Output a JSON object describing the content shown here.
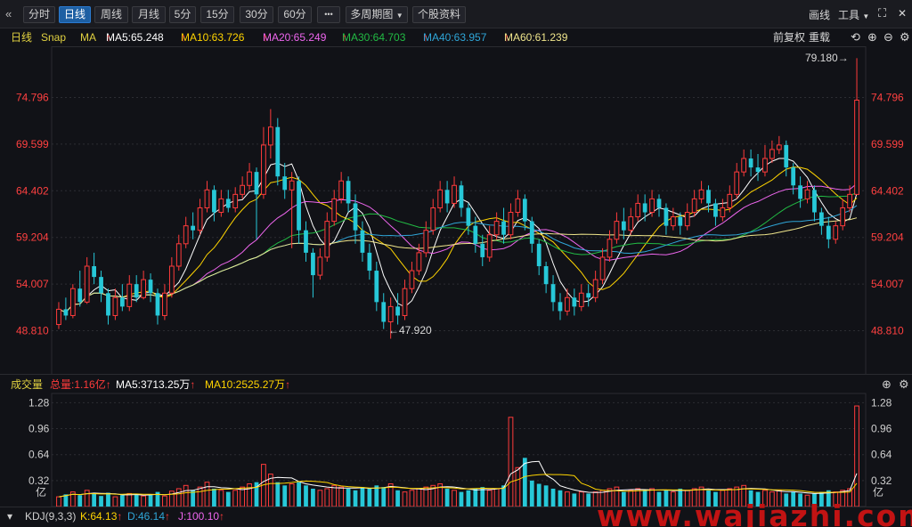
{
  "toolbar": {
    "back_glyph": "«",
    "periods": [
      "分时",
      "日线",
      "周线",
      "月线",
      "5分",
      "15分",
      "30分",
      "60分"
    ],
    "active_period": "日线",
    "more_glyph": "•••",
    "multi_period": "多周期图",
    "multi_period_arrow": "▼",
    "stock_info": "个股资料",
    "draw": "画线",
    "tools": "工具",
    "tools_arrow": "▼",
    "fullscreen_glyph": "⛶",
    "close_glyph": "✕"
  },
  "info": {
    "period_label": "日线",
    "snap": "Snap",
    "ma_label": "MA",
    "ma5": "MA5:65.248",
    "ma10": "MA10:63.726",
    "ma20": "MA20:65.249",
    "ma30": "MA30:64.703",
    "ma40": "MA40:63.957",
    "ma60": "MA60:61.239",
    "up_arrow": "↑",
    "adjust": "前复权",
    "overlay": "重载",
    "undo_glyph": "⟲",
    "zoom_in": "⊕",
    "zoom_out": "⊖",
    "settings_glyph": "⚙"
  },
  "price_axis": [
    "74.796",
    "69.599",
    "64.402",
    "59.204",
    "54.007",
    "48.810"
  ],
  "annotations": {
    "high": "79.180",
    "low": "47.920",
    "right_arrow": "→",
    "left_arrow": "←"
  },
  "volume": {
    "label": "成交量",
    "total": "总量:1.16亿",
    "ma5": "MA5:3713.25万",
    "ma10": "MA10:2525.27万",
    "up_arrow": "↑",
    "axis": [
      "1.28",
      "0.96",
      "0.64",
      "0.32"
    ],
    "unit": "亿",
    "settings_glyph": "⚙",
    "zoom_in": "⊕"
  },
  "kdj": {
    "collapse_glyph": "▾",
    "label": "KDJ(9,3,3)",
    "k": "K:64.13",
    "d": "D:46.14",
    "j": "J:100.10",
    "up_arrow": "↑",
    "settings_glyph": "⚙",
    "zoom_in": "⊕"
  },
  "watermark": "www.wajiazhi.com",
  "colors": {
    "up": "#ff3b3b",
    "down": "#27c8d8",
    "ma5": "#ffffff",
    "ma10": "#ffd400",
    "ma20": "#ee66ee",
    "ma30": "#22bb44",
    "ma40": "#2fa6d8",
    "ma60": "#f0e68c"
  },
  "chart_data": {
    "type": "candlestick",
    "price_range": [
      44.0,
      80.5
    ],
    "price_ticks": [
      74.796,
      69.599,
      64.402,
      59.204,
      54.007,
      48.81
    ],
    "volume_range_yi": [
      0,
      1.35
    ],
    "volume_ticks_yi": [
      1.28,
      0.96,
      0.64,
      0.32
    ],
    "candles": [
      [
        49.5,
        51.2,
        52.0,
        49.0
      ],
      [
        51.2,
        50.5,
        52.5,
        50.0
      ],
      [
        50.5,
        53.5,
        54.0,
        50.2
      ],
      [
        53.5,
        52.0,
        55.5,
        51.5
      ],
      [
        52.0,
        56.0,
        57.0,
        51.8
      ],
      [
        56.0,
        54.8,
        57.5,
        54.0
      ],
      [
        54.8,
        53.0,
        55.5,
        52.0
      ],
      [
        53.0,
        50.5,
        53.5,
        49.5
      ],
      [
        50.5,
        52.5,
        53.5,
        50.0
      ],
      [
        52.5,
        51.5,
        54.0,
        51.0
      ],
      [
        51.5,
        54.0,
        55.0,
        51.0
      ],
      [
        54.0,
        52.5,
        55.0,
        52.0
      ],
      [
        52.5,
        54.5,
        55.5,
        52.3
      ],
      [
        54.5,
        53.0,
        55.2,
        52.0
      ],
      [
        53.0,
        50.5,
        53.5,
        49.5
      ],
      [
        50.5,
        53.0,
        54.0,
        50.0
      ],
      [
        53.0,
        56.0,
        57.0,
        52.5
      ],
      [
        56.0,
        58.5,
        59.5,
        55.5
      ],
      [
        58.5,
        60.5,
        61.5,
        58.0
      ],
      [
        60.5,
        60.0,
        62.0,
        59.0
      ],
      [
        60.0,
        62.5,
        63.5,
        59.5
      ],
      [
        62.5,
        64.5,
        65.5,
        62.0
      ],
      [
        64.5,
        62.0,
        65.0,
        61.0
      ],
      [
        62.0,
        63.5,
        64.5,
        61.5
      ],
      [
        63.5,
        62.5,
        64.5,
        62.0
      ],
      [
        62.5,
        64.0,
        64.8,
        62.0
      ],
      [
        64.0,
        65.0,
        66.0,
        63.5
      ],
      [
        65.0,
        66.5,
        67.5,
        64.5
      ],
      [
        66.5,
        64.0,
        67.0,
        59.0
      ],
      [
        64.0,
        69.5,
        71.5,
        63.5
      ],
      [
        69.5,
        71.5,
        73.5,
        68.0
      ],
      [
        71.5,
        66.0,
        72.5,
        65.0
      ],
      [
        66.0,
        64.5,
        67.5,
        63.5
      ],
      [
        64.5,
        65.5,
        66.5,
        58.0
      ],
      [
        65.5,
        60.0,
        66.0,
        58.5
      ],
      [
        60.0,
        57.5,
        61.0,
        56.5
      ],
      [
        57.5,
        55.0,
        58.0,
        52.5
      ],
      [
        55.0,
        57.0,
        58.0,
        54.5
      ],
      [
        57.0,
        61.0,
        62.0,
        56.5
      ],
      [
        61.0,
        63.5,
        64.5,
        60.5
      ],
      [
        63.5,
        65.5,
        66.5,
        63.0
      ],
      [
        65.5,
        63.0,
        66.0,
        62.0
      ],
      [
        63.0,
        60.0,
        64.0,
        58.5
      ],
      [
        60.0,
        57.5,
        61.0,
        56.5
      ],
      [
        57.5,
        55.5,
        58.5,
        54.5
      ],
      [
        55.5,
        52.0,
        56.5,
        51.0
      ],
      [
        52.0,
        49.8,
        53.0,
        49.0
      ],
      [
        49.8,
        51.5,
        52.5,
        47.92
      ],
      [
        51.5,
        50.5,
        53.0,
        49.5
      ],
      [
        50.5,
        53.5,
        54.5,
        50.0
      ],
      [
        53.5,
        55.5,
        56.5,
        53.0
      ],
      [
        55.5,
        57.5,
        58.5,
        55.0
      ],
      [
        57.5,
        60.0,
        61.0,
        57.0
      ],
      [
        60.0,
        62.5,
        63.5,
        59.5
      ],
      [
        62.5,
        64.5,
        65.5,
        62.0
      ],
      [
        64.5,
        63.0,
        65.5,
        62.0
      ],
      [
        63.0,
        65.0,
        66.0,
        62.5
      ],
      [
        65.0,
        62.5,
        65.5,
        61.5
      ],
      [
        62.5,
        60.5,
        63.0,
        59.5
      ],
      [
        60.5,
        58.5,
        61.5,
        57.5
      ],
      [
        58.5,
        57.0,
        59.5,
        56.0
      ],
      [
        57.0,
        59.5,
        60.5,
        56.5
      ],
      [
        59.5,
        61.0,
        62.0,
        59.0
      ],
      [
        61.0,
        59.5,
        62.5,
        58.5
      ],
      [
        59.5,
        62.0,
        63.0,
        59.0
      ],
      [
        62.0,
        63.5,
        64.5,
        61.5
      ],
      [
        63.5,
        61.0,
        64.0,
        60.0
      ],
      [
        61.0,
        58.5,
        61.5,
        57.5
      ],
      [
        58.5,
        56.0,
        59.0,
        55.0
      ],
      [
        56.0,
        54.0,
        56.5,
        53.0
      ],
      [
        54.0,
        52.0,
        55.0,
        51.0
      ],
      [
        52.0,
        51.0,
        53.0,
        50.0
      ],
      [
        51.0,
        52.5,
        53.5,
        50.5
      ],
      [
        52.5,
        51.5,
        53.5,
        50.5
      ],
      [
        51.5,
        53.0,
        54.0,
        51.0
      ],
      [
        53.0,
        52.5,
        54.0,
        51.5
      ],
      [
        52.5,
        54.5,
        55.5,
        52.0
      ],
      [
        54.5,
        57.0,
        58.0,
        54.0
      ],
      [
        57.0,
        59.0,
        60.0,
        56.5
      ],
      [
        59.0,
        61.0,
        62.0,
        58.5
      ],
      [
        61.0,
        60.0,
        62.5,
        59.0
      ],
      [
        60.0,
        61.5,
        62.5,
        59.5
      ],
      [
        61.5,
        63.0,
        64.0,
        61.0
      ],
      [
        63.0,
        62.0,
        64.0,
        61.0
      ],
      [
        62.0,
        63.5,
        64.5,
        61.5
      ],
      [
        63.5,
        62.5,
        64.0,
        61.5
      ],
      [
        62.5,
        60.5,
        63.0,
        59.5
      ],
      [
        60.5,
        61.5,
        62.5,
        60.0
      ],
      [
        61.5,
        60.5,
        62.0,
        59.5
      ],
      [
        60.5,
        62.0,
        63.0,
        60.0
      ],
      [
        62.0,
        63.5,
        64.5,
        61.5
      ],
      [
        63.5,
        64.5,
        65.5,
        63.0
      ],
      [
        64.5,
        63.0,
        65.0,
        62.0
      ],
      [
        63.0,
        61.5,
        63.5,
        60.5
      ],
      [
        61.5,
        62.5,
        63.5,
        61.0
      ],
      [
        62.5,
        64.0,
        65.0,
        62.0
      ],
      [
        64.0,
        66.5,
        67.5,
        63.5
      ],
      [
        66.5,
        68.0,
        69.0,
        66.0
      ],
      [
        68.0,
        67.0,
        69.0,
        66.0
      ],
      [
        67.0,
        66.5,
        68.5,
        65.5
      ],
      [
        66.5,
        68.0,
        69.5,
        66.0
      ],
      [
        68.0,
        69.0,
        70.0,
        67.5
      ],
      [
        69.0,
        69.5,
        70.5,
        68.5
      ],
      [
        69.5,
        67.0,
        70.0,
        66.0
      ],
      [
        67.0,
        65.0,
        67.5,
        64.0
      ],
      [
        65.0,
        63.5,
        66.0,
        62.5
      ],
      [
        63.5,
        64.5,
        65.5,
        63.0
      ],
      [
        64.5,
        62.0,
        65.0,
        61.0
      ],
      [
        62.0,
        60.5,
        62.5,
        59.5
      ],
      [
        60.5,
        59.0,
        61.5,
        58.0
      ],
      [
        59.0,
        60.5,
        61.0,
        58.5
      ],
      [
        60.5,
        62.5,
        63.5,
        60.0
      ],
      [
        62.5,
        64.0,
        65.0,
        62.0
      ],
      [
        64.0,
        74.5,
        79.18,
        74.0
      ]
    ],
    "volumes_yi": [
      0.12,
      0.15,
      0.18,
      0.14,
      0.2,
      0.16,
      0.13,
      0.17,
      0.12,
      0.14,
      0.16,
      0.15,
      0.13,
      0.14,
      0.18,
      0.13,
      0.19,
      0.22,
      0.26,
      0.2,
      0.24,
      0.3,
      0.22,
      0.2,
      0.18,
      0.2,
      0.24,
      0.28,
      0.3,
      0.52,
      0.4,
      0.3,
      0.26,
      0.28,
      0.3,
      0.26,
      0.22,
      0.2,
      0.22,
      0.26,
      0.24,
      0.22,
      0.2,
      0.24,
      0.22,
      0.26,
      0.24,
      0.28,
      0.2,
      0.18,
      0.2,
      0.22,
      0.24,
      0.26,
      0.28,
      0.22,
      0.2,
      0.18,
      0.2,
      0.22,
      0.24,
      0.2,
      0.22,
      0.26,
      1.1,
      0.48,
      0.6,
      0.32,
      0.28,
      0.26,
      0.22,
      0.2,
      0.18,
      0.16,
      0.18,
      0.16,
      0.18,
      0.2,
      0.22,
      0.24,
      0.18,
      0.2,
      0.22,
      0.2,
      0.22,
      0.18,
      0.2,
      0.18,
      0.22,
      0.2,
      0.22,
      0.24,
      0.2,
      0.18,
      0.2,
      0.22,
      0.24,
      0.26,
      0.2,
      0.18,
      0.2,
      0.18,
      0.2,
      0.16,
      0.18,
      0.16,
      0.14,
      0.16,
      0.18,
      0.2,
      0.18,
      0.2,
      0.22,
      1.24
    ],
    "ma_periods": [
      5,
      10,
      20,
      30,
      40,
      60
    ]
  }
}
